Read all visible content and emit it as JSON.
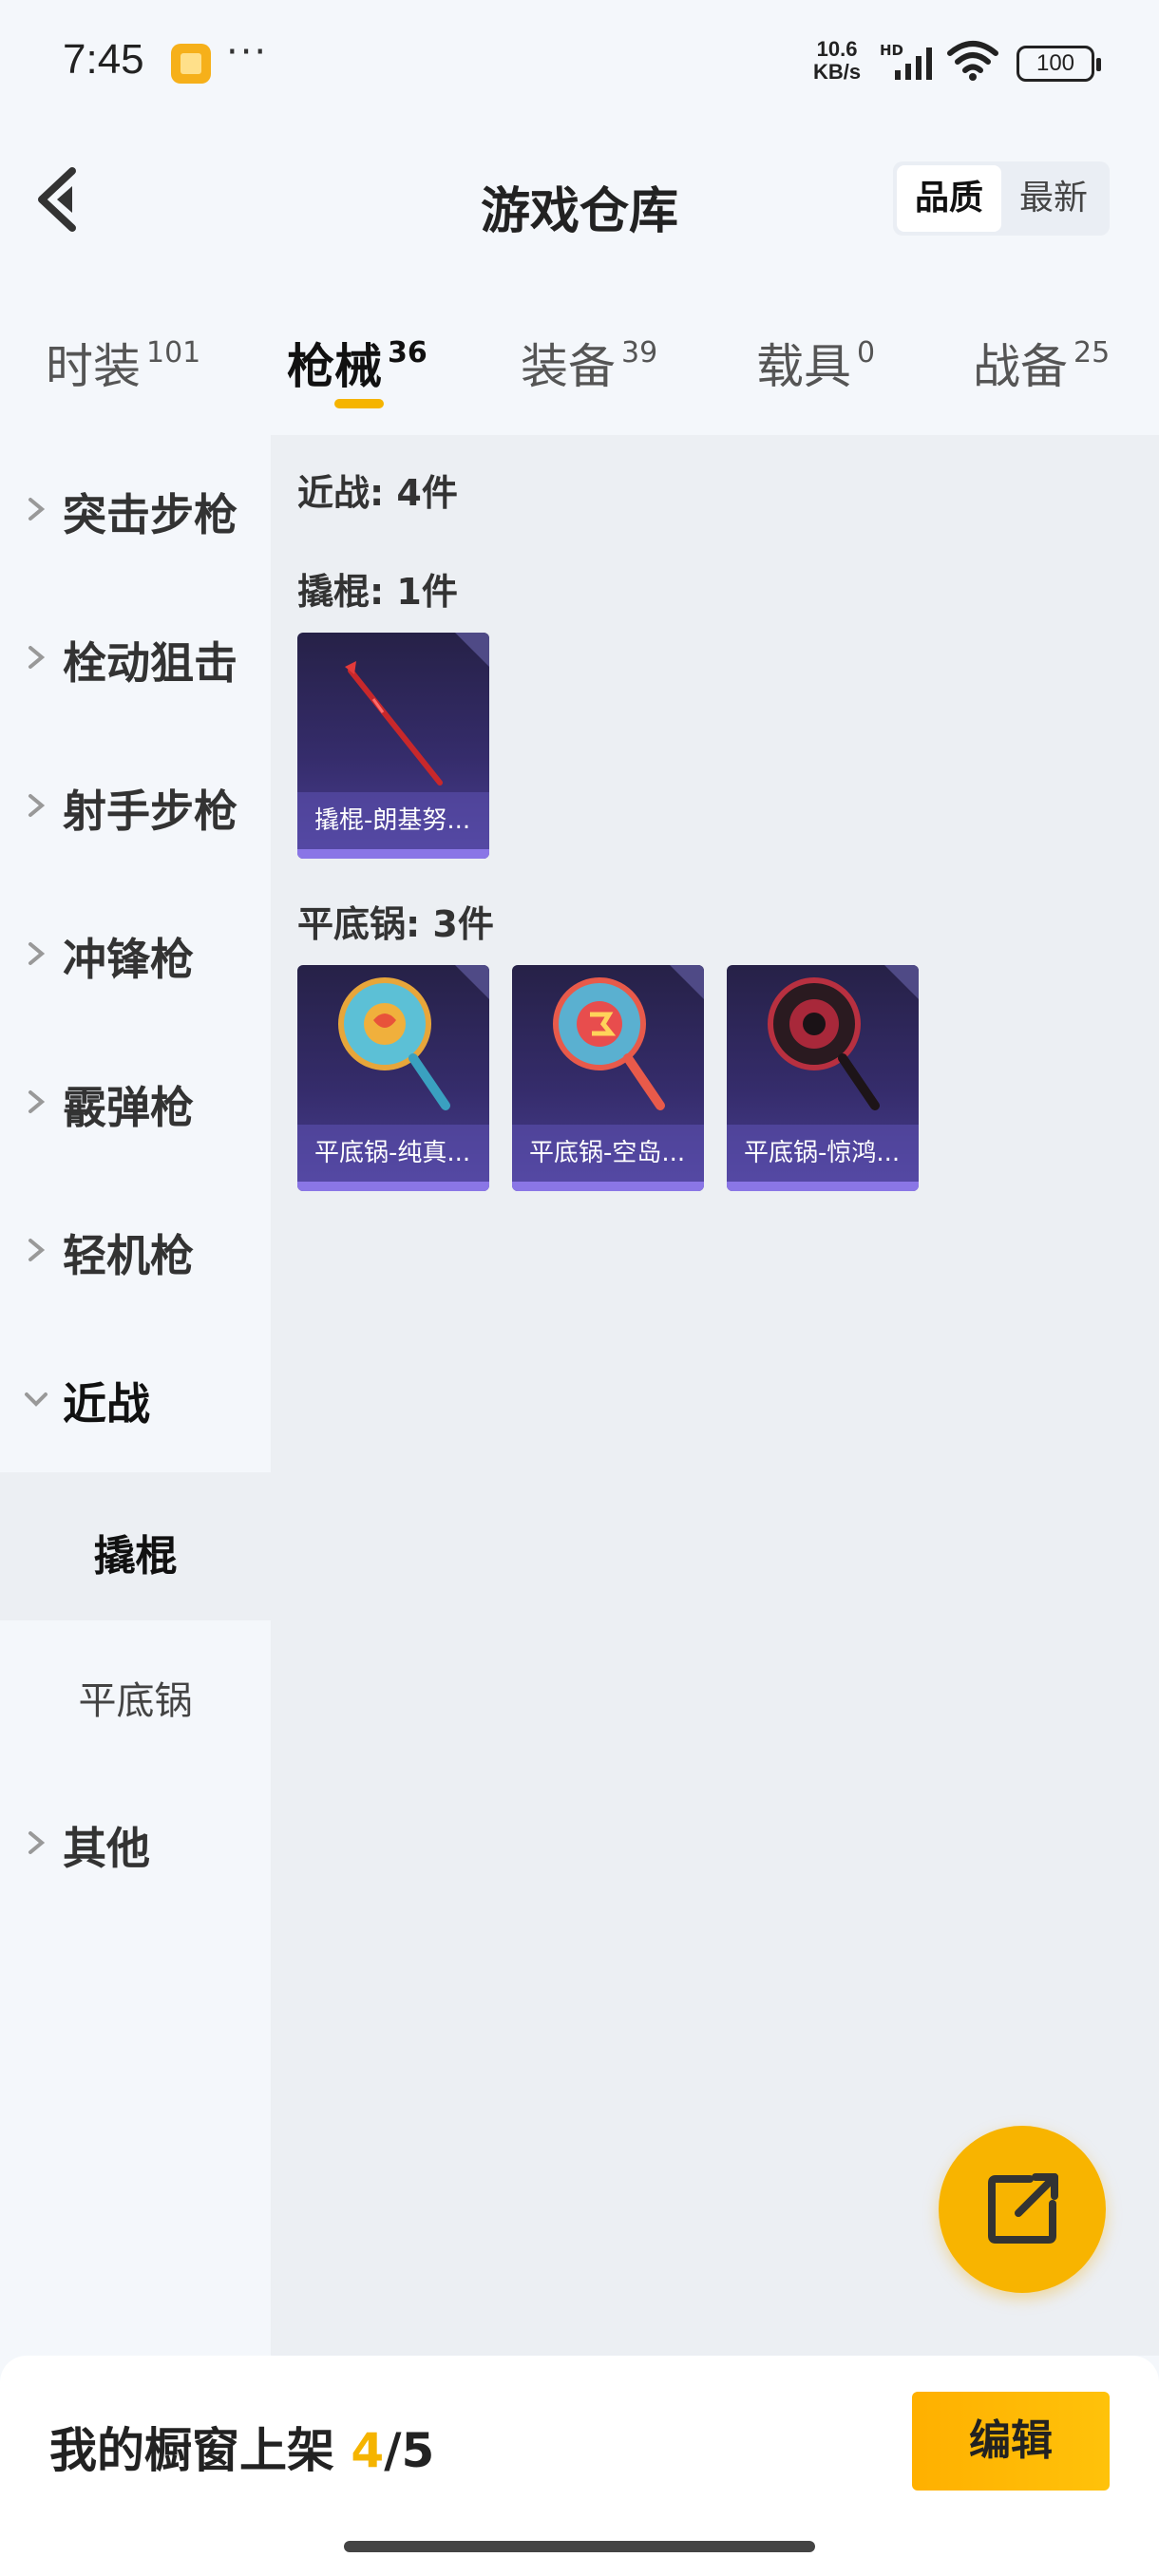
{
  "status_bar": {
    "time": "7:45",
    "more": "···",
    "speed_value": "10.6",
    "speed_unit": "KB/s",
    "hd": "HD",
    "battery": "100"
  },
  "header": {
    "title": "游戏仓库",
    "sort_options": [
      "品质",
      "最新"
    ],
    "sort_active": "品质"
  },
  "tabs": [
    {
      "label": "时装",
      "count": "101"
    },
    {
      "label": "枪械",
      "count": "36"
    },
    {
      "label": "装备",
      "count": "39"
    },
    {
      "label": "载具",
      "count": "0"
    },
    {
      "label": "战备",
      "count": "25"
    }
  ],
  "tab_active": "枪械",
  "sidebar": {
    "items": [
      {
        "label": "突击步枪"
      },
      {
        "label": "栓动狙击"
      },
      {
        "label": "射手步枪"
      },
      {
        "label": "冲锋枪"
      },
      {
        "label": "霰弹枪"
      },
      {
        "label": "轻机枪"
      },
      {
        "label": "近战"
      },
      {
        "label": "其他"
      }
    ],
    "subitems": [
      {
        "label": "撬棍"
      },
      {
        "label": "平底锅"
      }
    ],
    "selected_sub": "撬棍"
  },
  "content": {
    "summary": "近战: 4件",
    "groups": [
      {
        "label": "撬棍: 1件",
        "items": [
          {
            "name": "撬棍-朗基努..."
          }
        ]
      },
      {
        "label": "平底锅: 3件",
        "items": [
          {
            "name": "平底锅-纯真..."
          },
          {
            "name": "平底锅-空岛..."
          },
          {
            "name": "平底锅-惊鸿..."
          }
        ]
      }
    ]
  },
  "bottom": {
    "showcase_label": "我的橱窗上架",
    "showcase_current": "4",
    "showcase_sep": "/",
    "showcase_total": "5",
    "edit_label": "编辑"
  },
  "icons": {
    "back": "back-arrow-icon",
    "fab": "share-external-icon",
    "chevron": "chevron-right-icon"
  },
  "colors": {
    "accent": "#f5b400",
    "card_bg": "#352c6b",
    "content_bg": "#eceff3"
  }
}
